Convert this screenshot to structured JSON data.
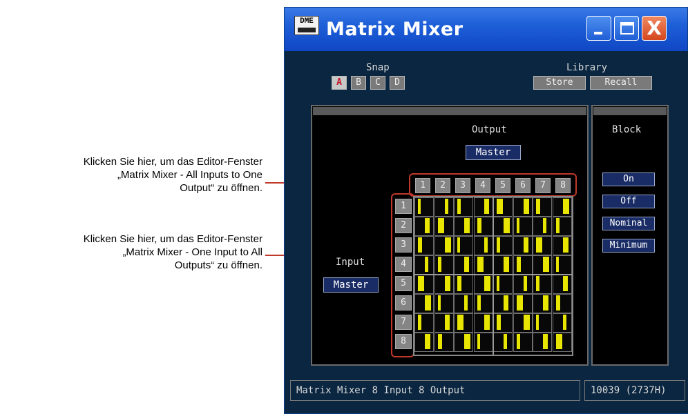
{
  "callouts": {
    "first": [
      "Klicken Sie hier, um das Editor-Fenster",
      "„Matrix Mixer - All Inputs to One",
      "Output“ zu öffnen."
    ],
    "second": [
      "Klicken Sie hier, um das Editor-Fenster",
      "„Matrix Mixer - One Input to All",
      "Outputs“ zu öffnen."
    ],
    "accent_color": "#c0392b"
  },
  "window": {
    "icon_text": "DME",
    "title": "Matrix Mixer",
    "controls": [
      "minimize-icon",
      "maximize-icon",
      "close-icon"
    ],
    "close_glyph": "X"
  },
  "snap": {
    "label": "Snap",
    "buttons": [
      "A",
      "B",
      "C",
      "D"
    ],
    "active": "A"
  },
  "library": {
    "label": "Library",
    "store": "Store",
    "recall": "Recall"
  },
  "output": {
    "label": "Output",
    "master": "Master",
    "columns": [
      "1",
      "2",
      "3",
      "4",
      "5",
      "6",
      "7",
      "8"
    ]
  },
  "input": {
    "label": "Input",
    "master": "Master",
    "rows": [
      "1",
      "2",
      "3",
      "4",
      "5",
      "6",
      "7",
      "8"
    ]
  },
  "block": {
    "label": "Block",
    "on": "On",
    "off": "Off",
    "nominal": "Nominal",
    "minimum": "Minimum"
  },
  "matrix_levels": [
    [
      0.9,
      0.9,
      0.9,
      0.9,
      0.9,
      0.9,
      0.9,
      0.9
    ],
    [
      0.9,
      0.9,
      0.9,
      0.9,
      0.9,
      0.9,
      0.9,
      0.9
    ],
    [
      0.9,
      0.9,
      0.9,
      0.9,
      0.9,
      0.9,
      0.9,
      0.9
    ],
    [
      0.9,
      0.9,
      0.9,
      0.9,
      0.9,
      0.9,
      0.9,
      0.9
    ],
    [
      0.9,
      0.9,
      0.9,
      0.9,
      0.9,
      0.9,
      0.9,
      0.9
    ],
    [
      0.9,
      0.9,
      0.9,
      0.9,
      0.9,
      0.9,
      0.9,
      0.9
    ],
    [
      0.9,
      0.9,
      0.9,
      0.9,
      0.9,
      0.9,
      0.9,
      0.9
    ],
    [
      0.9,
      0.9,
      0.9,
      0.9,
      0.9,
      0.9,
      0.9,
      0.9
    ]
  ],
  "fader_color": "#e8e600",
  "status": {
    "component": "Matrix Mixer   8 Input 8 Output",
    "id": "10039 (2737H)"
  }
}
